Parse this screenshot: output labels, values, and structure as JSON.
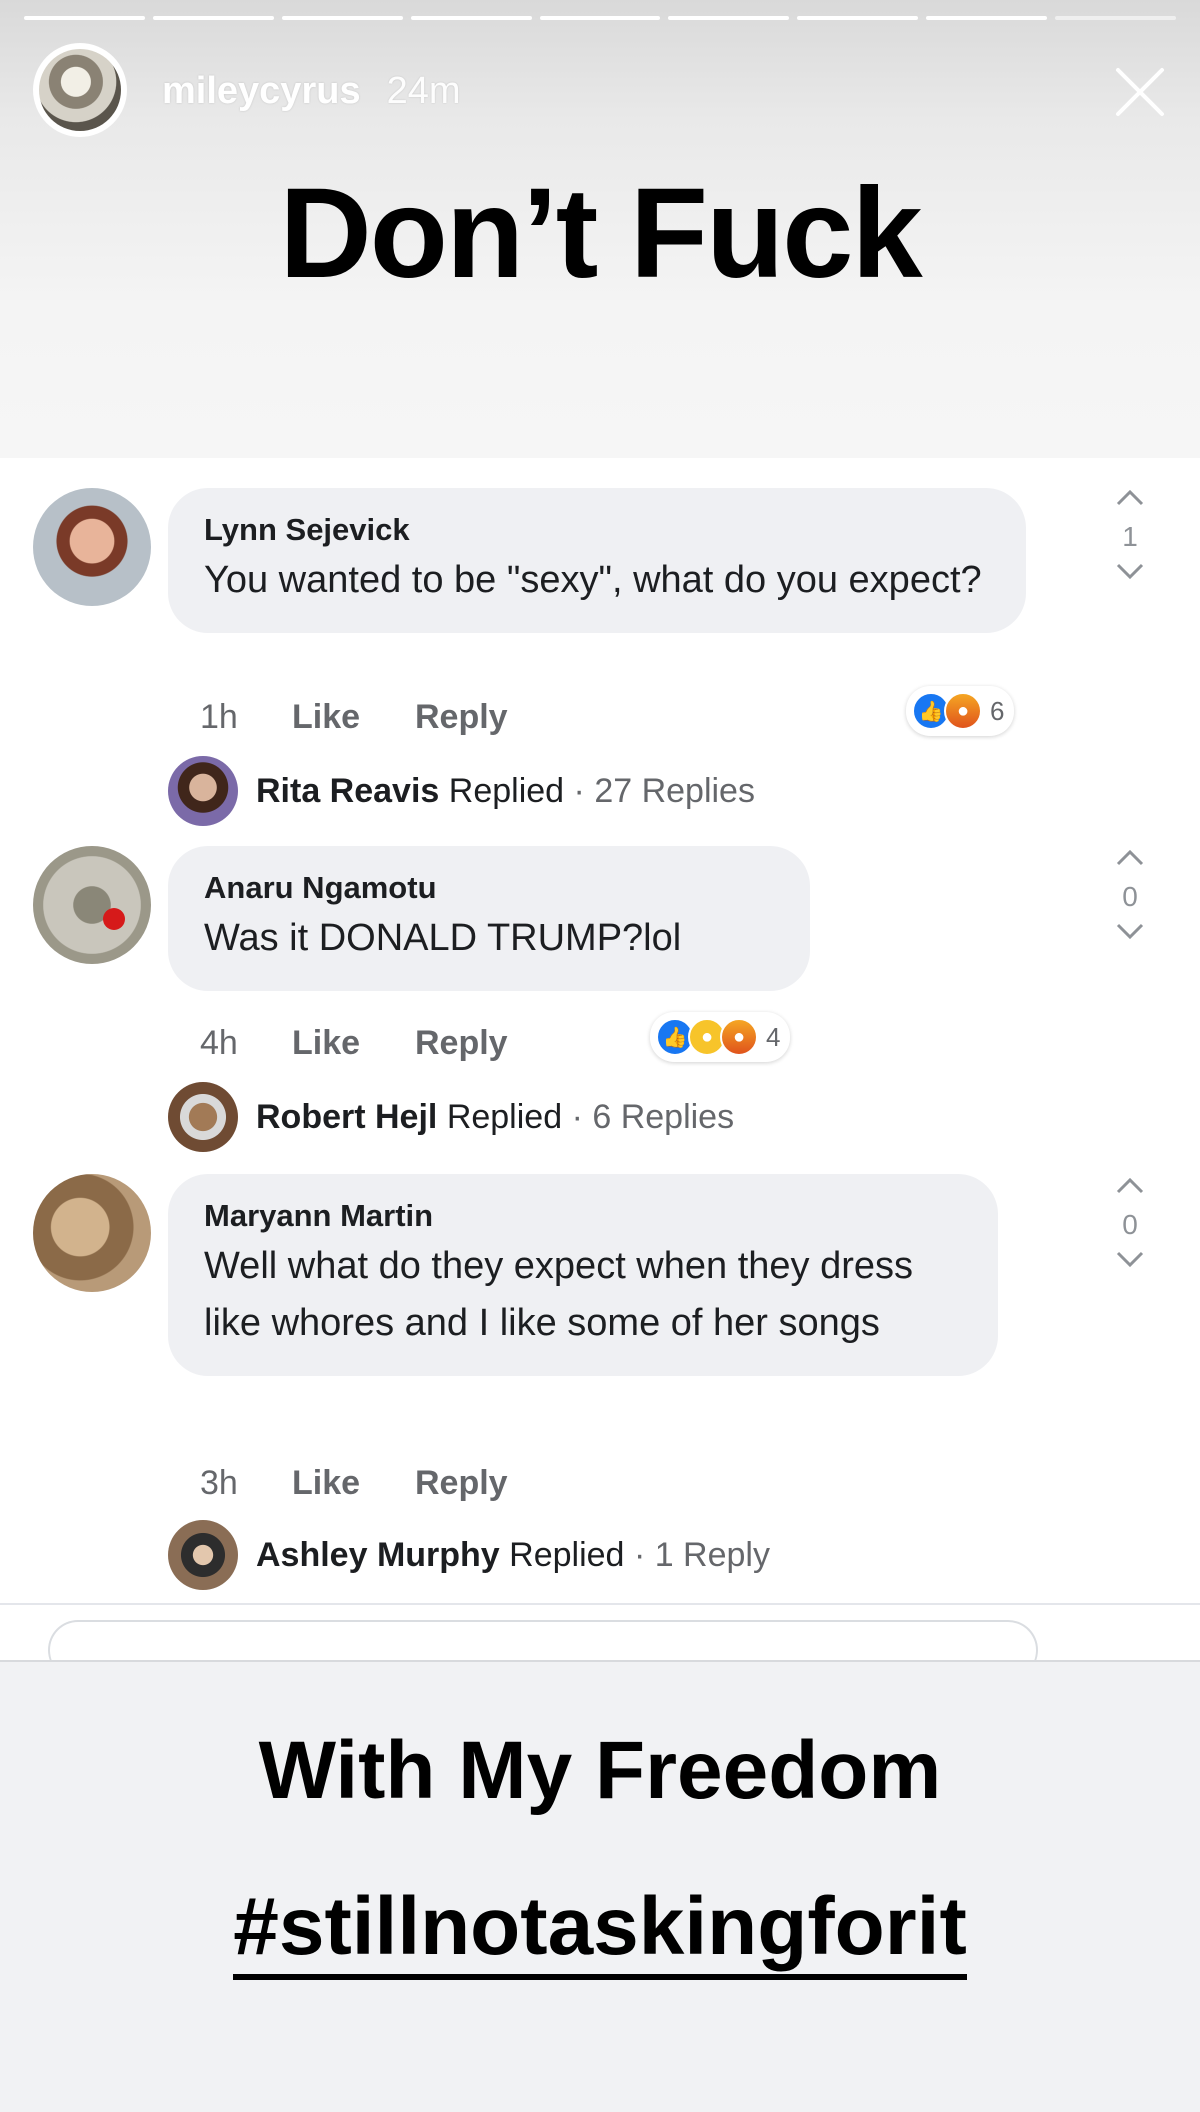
{
  "story": {
    "username": "mileycyrus",
    "time": "24m",
    "progress_segments": 9,
    "progress_done": 8
  },
  "overlay_text": {
    "top": "Don’t Fuck",
    "bottom": "With My Freedom",
    "hashtag": "#stillnotaskingforit"
  },
  "comments": [
    {
      "author": "Lynn Sejevick",
      "text": "You wanted to be \"sexy\", what do you expect?",
      "time": "1h",
      "like_label": "Like",
      "reply_label": "Reply",
      "reaction_count": "6",
      "reactions": [
        "like-reaction",
        "angry-reaction"
      ],
      "vote_count": "1",
      "replied_by": "Rita Reavis",
      "replied_label": "Replied",
      "reply_count": "· 27 Replies"
    },
    {
      "author": "Anaru Ngamotu",
      "text": "Was it DONALD TRUMP?lol",
      "time": "4h",
      "like_label": "Like",
      "reply_label": "Reply",
      "reaction_count": "4",
      "reactions": [
        "like-reaction",
        "haha-reaction",
        "angry-reaction"
      ],
      "vote_count": "0",
      "replied_by": "Robert Hejl",
      "replied_label": "Replied",
      "reply_count": "· 6 Replies"
    },
    {
      "author": "Maryann Martin",
      "text": "Well what do they expect when they dress like whores and I like some of her songs",
      "time": "3h",
      "like_label": "Like",
      "reply_label": "Reply",
      "vote_count": "0",
      "replied_by": "Ashley Murphy",
      "replied_label": "Replied",
      "reply_count": "· 1 Reply"
    }
  ],
  "colors": {
    "bubble": "#eff0f3",
    "like_blue": "#1877f2",
    "meta_gray": "#65676b"
  }
}
